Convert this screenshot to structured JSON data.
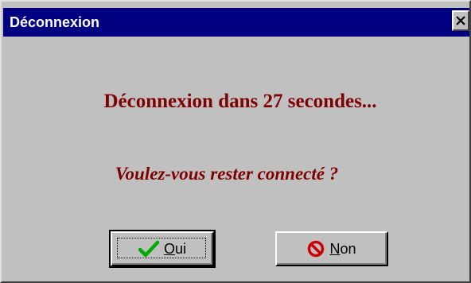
{
  "window": {
    "title": "Déconnexion"
  },
  "message": {
    "heading": "Déconnexion dans 27 secondes...",
    "question": "Voulez-vous rester connecté ?"
  },
  "buttons": {
    "yes": {
      "mnemonic": "O",
      "rest": "ui",
      "icon": "checkmark-icon"
    },
    "no": {
      "mnemonic": "N",
      "rest": "on",
      "icon": "no-entry-icon"
    }
  },
  "colors": {
    "titlebar": "#000080",
    "message_text": "#7f0000",
    "dialog_face": "#c0c0c0",
    "check": "#00aa00",
    "no_sign": "#cc0000"
  }
}
